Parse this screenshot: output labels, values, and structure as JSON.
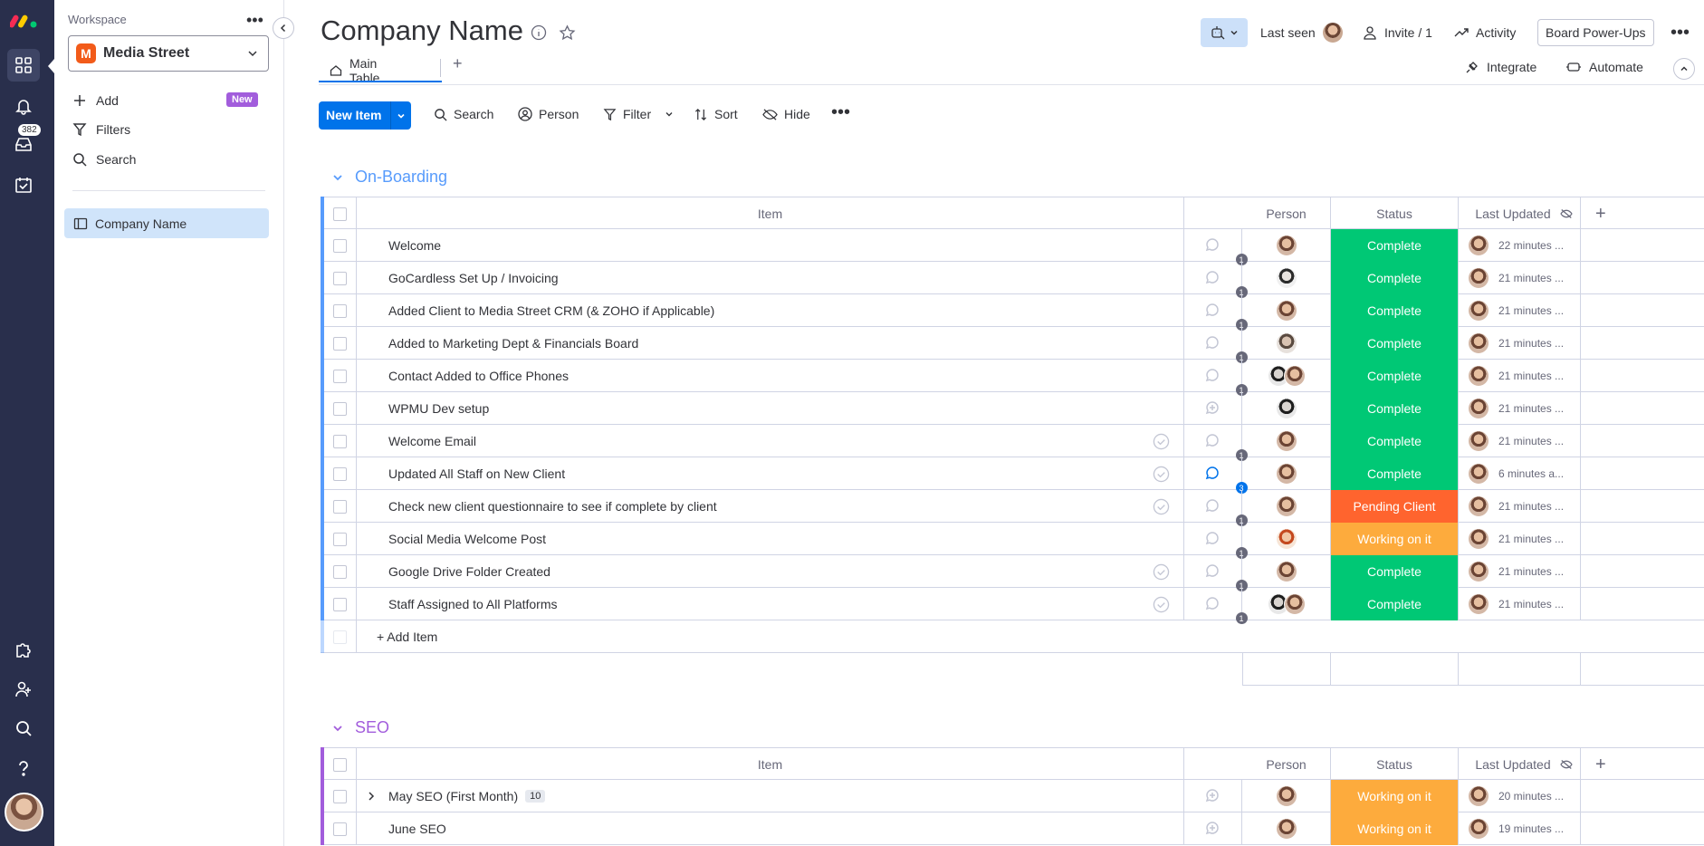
{
  "rail": {
    "badge": "382"
  },
  "workspace": {
    "label": "Workspace",
    "more": "•••",
    "initial": "M",
    "name": "Media Street",
    "add": "Add",
    "new_badge": "New",
    "filters": "Filters",
    "search": "Search",
    "board": "Company Name"
  },
  "header": {
    "title": "Company Name",
    "last_seen": "Last seen",
    "invite": "Invite / 1",
    "activity": "Activity",
    "powerups": "Board Power-Ups",
    "tab_main": "Main Table",
    "tab_add": "+",
    "integrate": "Integrate",
    "automate": "Automate"
  },
  "toolbar": {
    "new_item": "New Item",
    "search": "Search",
    "person": "Person",
    "filter": "Filter",
    "sort": "Sort",
    "hide": "Hide"
  },
  "colors": {
    "complete": "#00c875",
    "pending": "#ff642e",
    "working": "#fdab3d",
    "onboarding": "#579bfc",
    "seo": "#a25ddc",
    "accent": "#0073ea"
  },
  "columns": {
    "item": "Item",
    "person": "Person",
    "status": "Status",
    "last_updated": "Last Updated",
    "add": "+"
  },
  "groups": [
    {
      "title": "On-Boarding",
      "add_item": "+ Add Item",
      "rows": [
        {
          "name": "Welcome",
          "updates": "1",
          "status": "Complete",
          "last": "22 minutes ..."
        },
        {
          "name": "GoCardless Set Up / Invoicing",
          "updates": "1",
          "status": "Complete",
          "last": "21 minutes ..."
        },
        {
          "name": "Added Client to Media Street CRM (& ZOHO if Applicable)",
          "updates": "1",
          "status": "Complete",
          "last": "21 minutes ..."
        },
        {
          "name": "Added to Marketing Dept & Financials Board",
          "updates": "1",
          "status": "Complete",
          "last": "21 minutes ..."
        },
        {
          "name": "Contact Added to Office Phones",
          "updates": "1",
          "status": "Complete",
          "last": "21 minutes ..."
        },
        {
          "name": "WPMU Dev setup",
          "updates": "",
          "status": "Complete",
          "last": "21 minutes ..."
        },
        {
          "name": "Welcome Email",
          "updates": "1",
          "status": "Complete",
          "last": "21 minutes ..."
        },
        {
          "name": "Updated All Staff on New Client",
          "updates": "3",
          "status": "Complete",
          "last": "6 minutes a..."
        },
        {
          "name": "Check new client questionnaire to see if complete by client",
          "updates": "1",
          "status": "Pending Client",
          "last": "21 minutes ..."
        },
        {
          "name": "Social Media Welcome Post",
          "updates": "1",
          "status": "Working on it",
          "last": "21 minutes ..."
        },
        {
          "name": "Google Drive Folder Created",
          "updates": "1",
          "status": "Complete",
          "last": "21 minutes ..."
        },
        {
          "name": "Staff Assigned to All Platforms",
          "updates": "1",
          "status": "Complete",
          "last": "21 minutes ..."
        }
      ]
    },
    {
      "title": "SEO",
      "rows": [
        {
          "name": "May SEO (First Month)",
          "subitems": "10",
          "status": "Working on it",
          "last": "20 minutes ..."
        },
        {
          "name": "June SEO",
          "status": "Working on it",
          "last": "19 minutes ..."
        }
      ]
    }
  ]
}
